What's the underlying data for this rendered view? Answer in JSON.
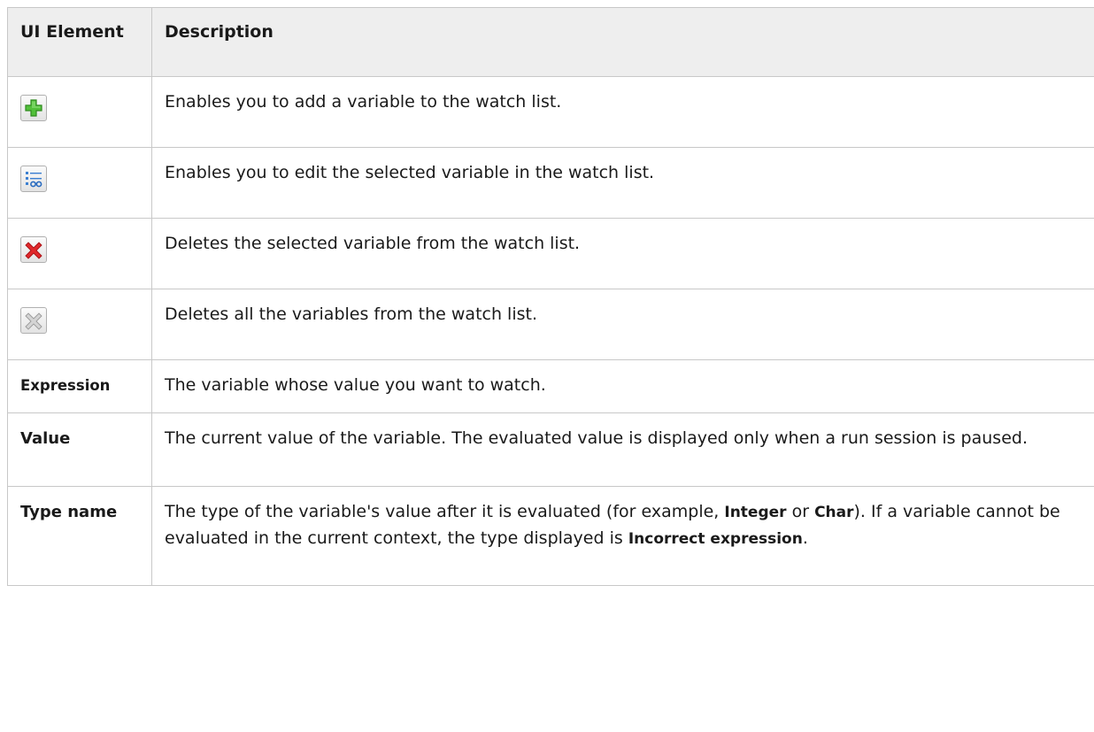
{
  "table": {
    "header": {
      "ui_element": "UI Element",
      "description": "Description"
    },
    "rows": [
      {
        "icon": "add-variable-icon",
        "description": "Enables you to add a variable to the watch list."
      },
      {
        "icon": "edit-variable-icon",
        "description": "Enables you to edit the selected variable in the watch list."
      },
      {
        "icon": "delete-variable-icon",
        "description": "Deletes the selected variable from the watch list."
      },
      {
        "icon": "delete-all-variables-icon",
        "description": "Deletes all the variables from the watch list."
      },
      {
        "element": "Expression",
        "description": "The variable whose value you want to watch."
      },
      {
        "element": "Value",
        "description": "The current value of the variable. The evaluated value is displayed only when a run session is paused."
      },
      {
        "element": "Type name",
        "description_parts": {
          "p1": "The type of the variable's value after it is evaluated (for example, ",
          "b1": "Integer",
          "p2": " or ",
          "b2": "Char",
          "p3": "). If a variable cannot be evaluated in the current context, the type displayed is ",
          "b3": "Incorrect expression",
          "p4": "."
        }
      }
    ]
  },
  "colors": {
    "add_green": "#3fae2a",
    "delete_red": "#e0282b",
    "delete_all_gray": "#a8a8a8",
    "edit_blue": "#2a6cc0",
    "header_bg": "#eeeeee",
    "border": "#c8c8c8"
  }
}
